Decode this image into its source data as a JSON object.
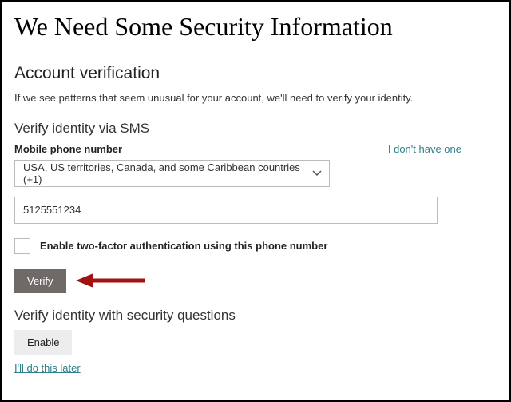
{
  "header": {
    "title": "We Need Some Security Information"
  },
  "account_verification": {
    "heading": "Account verification",
    "description": "If we see patterns that seem unusual for your account, we'll need to verify your identity."
  },
  "sms": {
    "heading": "Verify identity via SMS",
    "phone_label": "Mobile phone number",
    "no_phone_link": "I don't have one",
    "country_select": "USA, US territories, Canada, and some Caribbean countries (+1)",
    "phone_value": "5125551234",
    "checkbox_label": "Enable two-factor authentication using this phone number",
    "verify_button": "Verify"
  },
  "security_questions": {
    "heading": "Verify identity with security questions",
    "enable_button": "Enable"
  },
  "footer": {
    "later_link": "I'll do this later"
  }
}
